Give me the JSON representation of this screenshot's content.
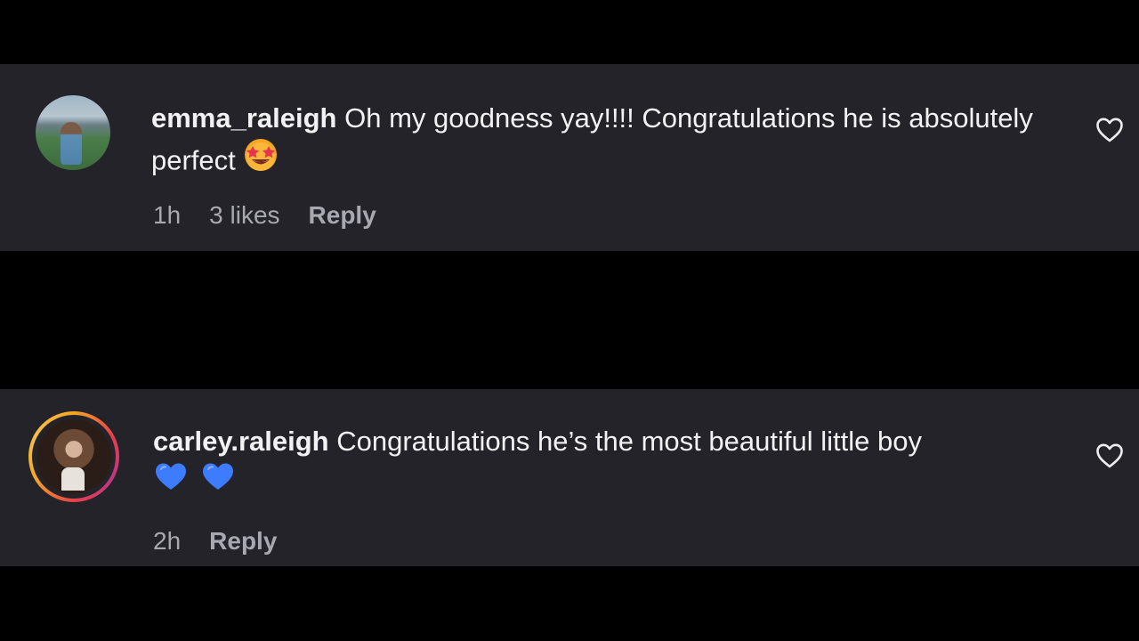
{
  "comments": [
    {
      "username": "emma_raleigh",
      "text": "Oh my goodness yay!!!! Congratulations he is absolutely perfect",
      "emoji": "star-struck-emoji",
      "time": "1h",
      "likes": "3 likes",
      "reply_label": "Reply",
      "like_icon": "heart-outline-icon"
    },
    {
      "username": "carley.raleigh",
      "text": "Congratulations he’s the most beautiful little boy",
      "emoji": "blue-heart-emoji",
      "time": "2h",
      "reply_label": "Reply",
      "like_icon": "heart-outline-icon"
    }
  ],
  "colors": {
    "page_background": "#000000",
    "comment_background": "#232329",
    "text_primary": "#f2f2f4",
    "text_secondary": "#a8a8b0",
    "blue_heart": "#3d7bff"
  }
}
